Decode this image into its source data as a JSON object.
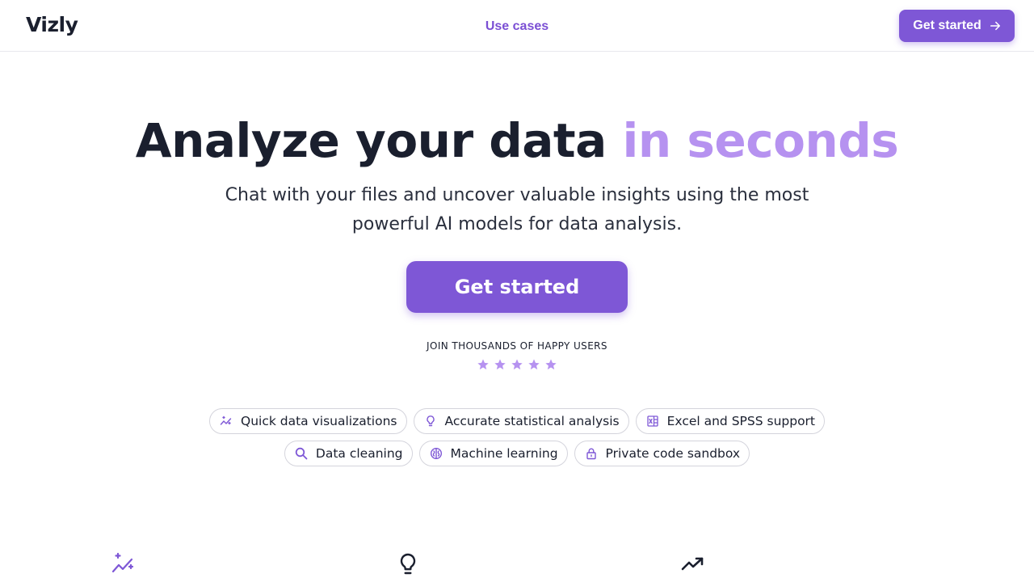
{
  "header": {
    "logo": "Vizly",
    "nav_link": "Use cases",
    "cta_label": "Get started"
  },
  "hero": {
    "title_main": "Analyze your data ",
    "title_accent": "in seconds",
    "subtitle": "Chat with your files and uncover valuable insights using the most powerful AI models for data analysis.",
    "cta_label": "Get started",
    "social_proof": "JOIN THOUSANDS OF HAPPY USERS",
    "rating": 5
  },
  "features": {
    "row1": [
      {
        "label": "Quick data visualizations",
        "icon": "sparkle-chart-icon"
      },
      {
        "label": "Accurate statistical analysis",
        "icon": "lightbulb-icon"
      },
      {
        "label": "Excel and SPSS support",
        "icon": "excel-file-icon"
      }
    ],
    "row2": [
      {
        "label": "Data cleaning",
        "icon": "search-icon"
      },
      {
        "label": "Machine learning",
        "icon": "brain-icon"
      },
      {
        "label": "Private code sandbox",
        "icon": "lock-icon"
      }
    ]
  },
  "colors": {
    "accent": "#7e57d6",
    "accent_light": "#b692f0",
    "text": "#1a1f2e"
  }
}
